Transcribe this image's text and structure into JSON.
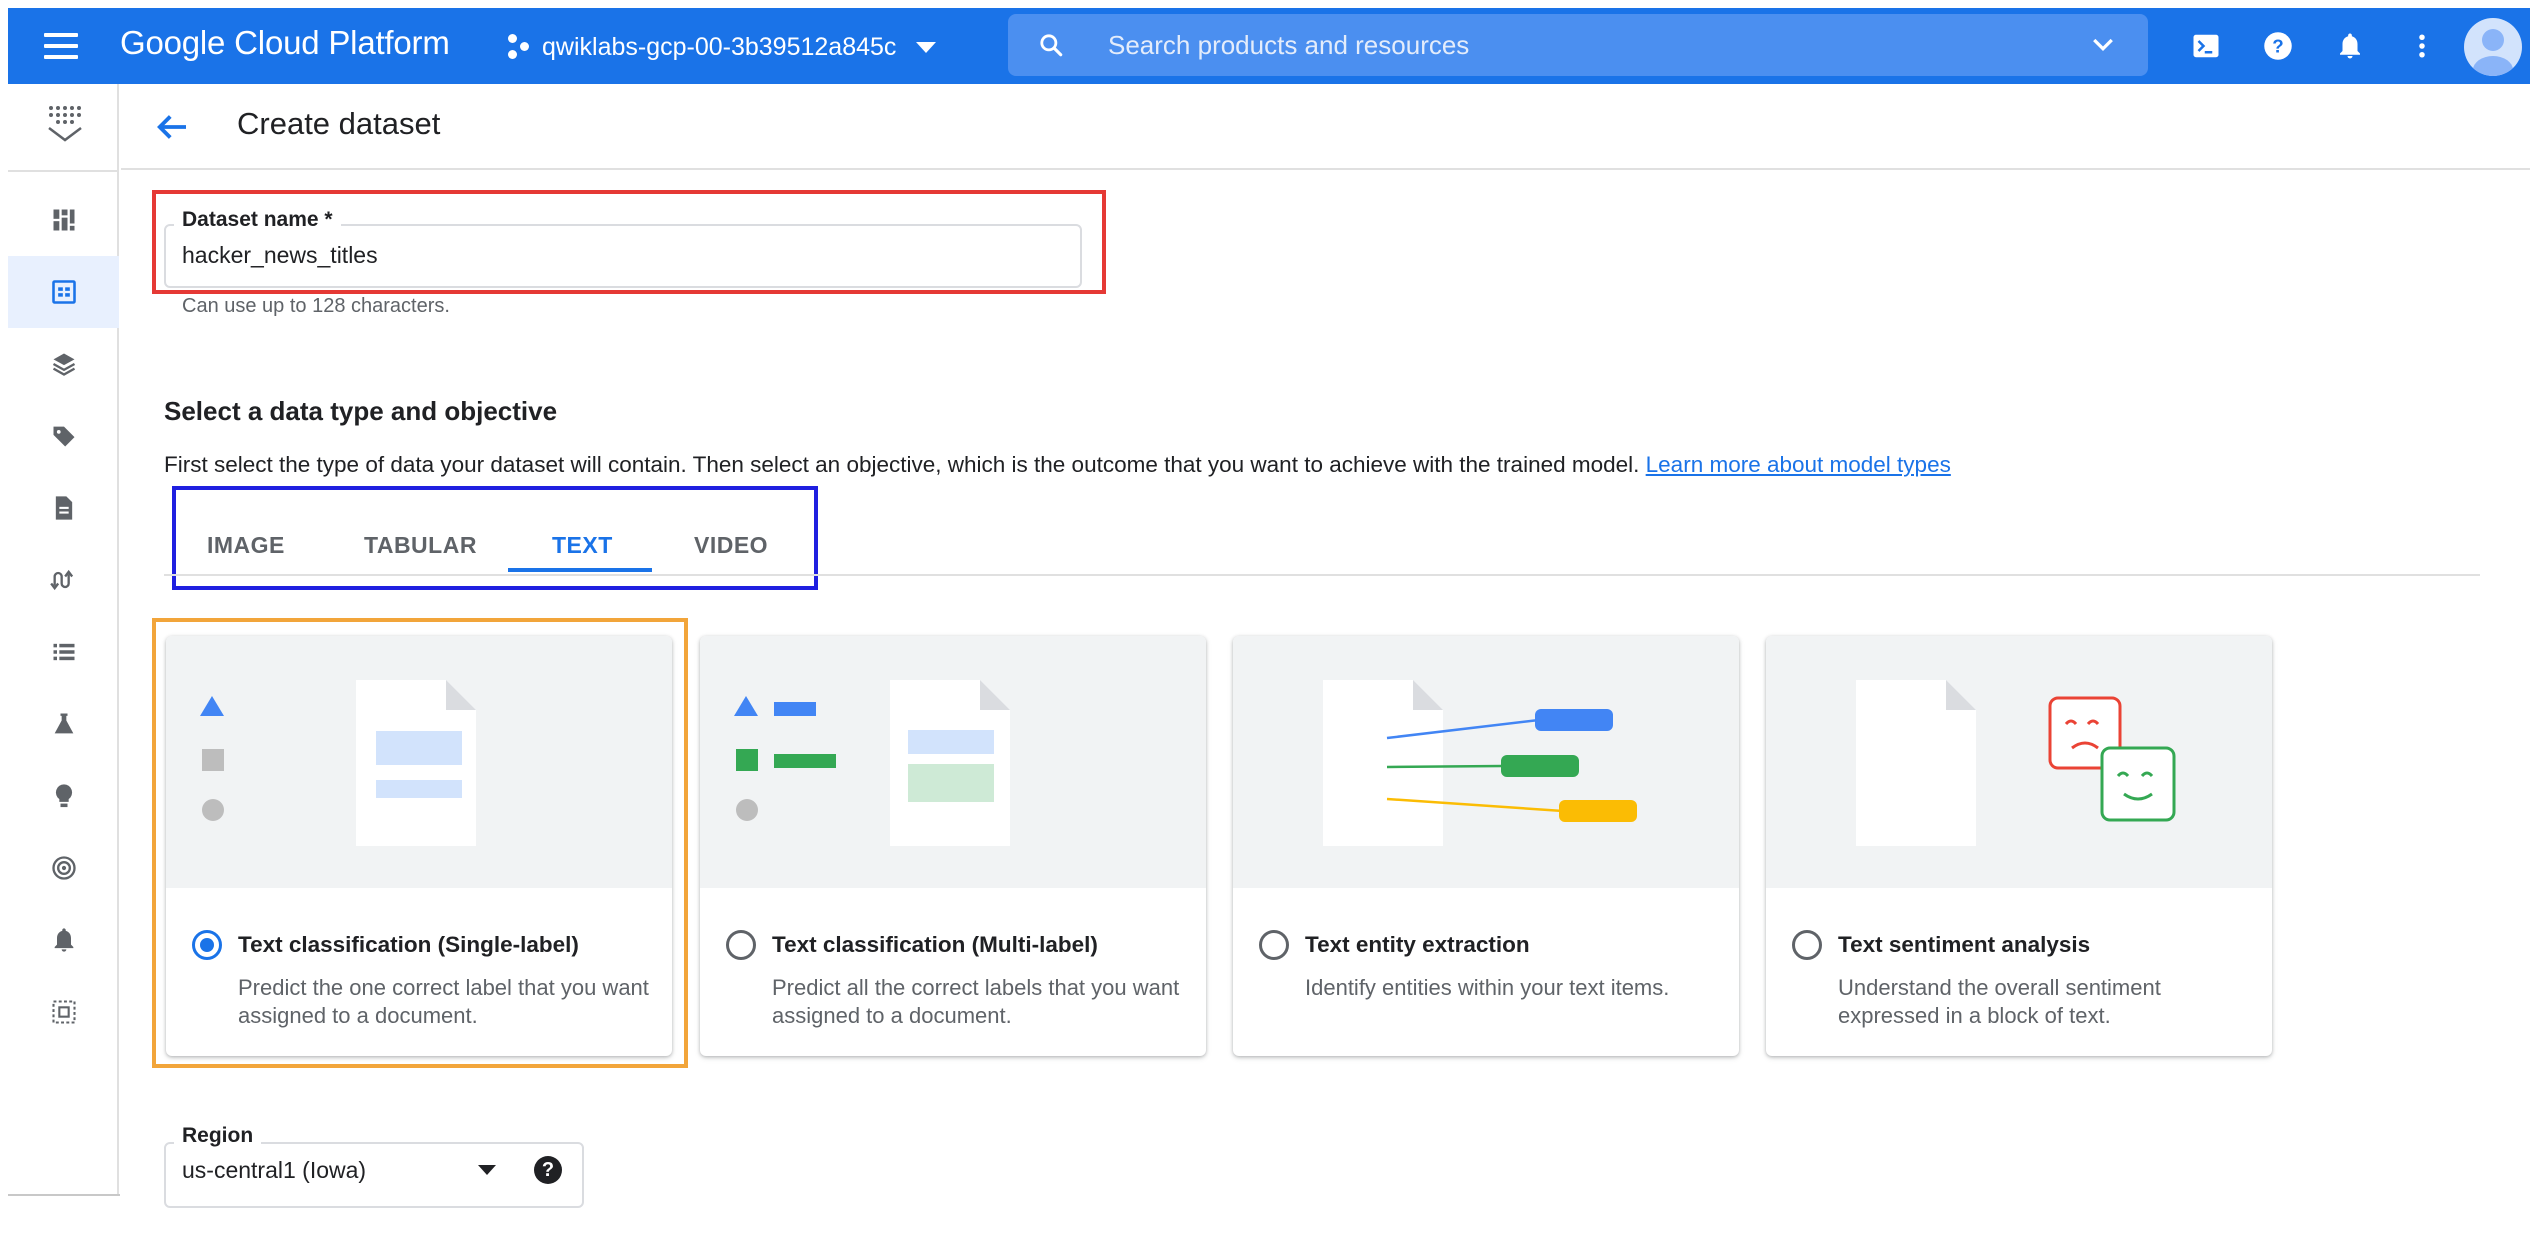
{
  "topbar": {
    "brand": "Google Cloud Platform",
    "project": "qwiklabs-gcp-00-3b39512a845c",
    "search_placeholder": "Search products and resources",
    "icons": [
      "menu-icon",
      "search-icon",
      "chevron-down-icon",
      "cloud-shell-icon",
      "help-icon",
      "notifications-icon",
      "more-vert-icon",
      "account-icon"
    ],
    "color": "#1a73e8"
  },
  "rail": {
    "logo": "vertex-ai-logo-icon",
    "items": [
      {
        "icon": "dashboard-icon",
        "active": false
      },
      {
        "icon": "datasets-icon",
        "active": true
      },
      {
        "icon": "feature-store-icon",
        "active": false
      },
      {
        "icon": "labeling-tasks-icon",
        "active": false
      },
      {
        "icon": "notebooks-icon",
        "active": false
      },
      {
        "icon": "pipelines-icon",
        "active": false
      },
      {
        "icon": "training-icon",
        "active": false
      },
      {
        "icon": "experiments-icon",
        "active": false
      },
      {
        "icon": "models-icon",
        "active": false
      },
      {
        "icon": "endpoints-icon",
        "active": false
      },
      {
        "icon": "monitoring-icon",
        "active": false
      },
      {
        "icon": "batch-predictions-icon",
        "active": false
      }
    ]
  },
  "header": {
    "title": "Create dataset"
  },
  "dataset_name": {
    "label": "Dataset name *",
    "value": "hacker_news_titles",
    "hint": "Can use up to 128 characters."
  },
  "section": {
    "title": "Select a data type and objective",
    "description": "First select the type of data your dataset will contain. Then select an objective, which is the outcome that you want to achieve with the trained model.",
    "link": "Learn more about model types"
  },
  "tabs": [
    {
      "label": "IMAGE",
      "active": false
    },
    {
      "label": "TABULAR",
      "active": false
    },
    {
      "label": "TEXT",
      "active": true
    },
    {
      "label": "VIDEO",
      "active": false
    }
  ],
  "cards": [
    {
      "title": "Text classification (Single-label)",
      "description": "Predict the one correct label that you want assigned to a document.",
      "selected": true
    },
    {
      "title": "Text classification (Multi-label)",
      "description": "Predict all the correct labels that you want assigned to a document.",
      "selected": false
    },
    {
      "title": "Text entity extraction",
      "description": "Identify entities within your text items.",
      "selected": false
    },
    {
      "title": "Text sentiment analysis",
      "description": "Understand the overall sentiment expressed in a block of text.",
      "selected": false
    }
  ],
  "region": {
    "label": "Region",
    "value": "us-central1 (Iowa)",
    "help": "?"
  },
  "highlight_colors": {
    "red": "#e53935",
    "blue": "#1f1fe0",
    "orange": "#f2a53a"
  }
}
